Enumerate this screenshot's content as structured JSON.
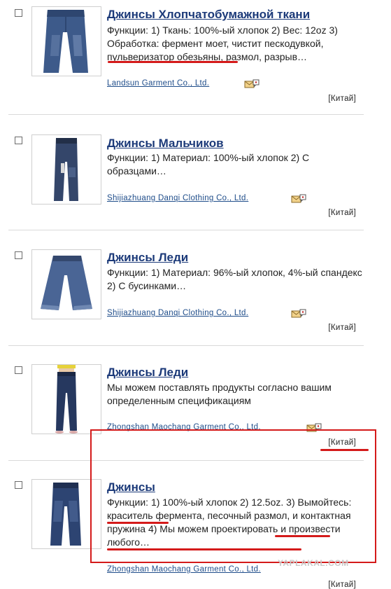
{
  "listings": [
    {
      "title": "Джинсы Хлопчатобумажной ткани",
      "description": "Функции: 1) Ткань: 100%-ый хлопок 2) Вес: 12oz 3) Обработка: фермент моет, чистит пескодувкой, пульверизатор обезьяны, размол, разрыв…",
      "company": "Landsun Garment Co., Ltd.",
      "country": "[Китай]"
    },
    {
      "title": "Джинсы Мальчиков",
      "description": "Функции: 1) Материал: 100%-ый хлопок 2) С образцами…",
      "company": "Shijiazhuang Danqi Clothing Co., Ltd.",
      "country": "[Китай]"
    },
    {
      "title": "Джинсы Леди",
      "description": "Функции: 1) Материал: 96%-ый хлопок, 4%-ый спандекс 2) С бусинками…",
      "company": "Shijiazhuang Danqi Clothing Co., Ltd.",
      "country": "[Китай]"
    },
    {
      "title": "Джинсы Леди",
      "description": "Мы можем поставлять продукты согласно вашим определенным спецификациям",
      "company": "Zhongshan Maochang Garment Co., Ltd.",
      "country": "[Китай]"
    },
    {
      "title": "Джинсы",
      "description": "Функции: 1) 100%-ый хлопок 2) 12.5oz. 3) Вымойтесь: краситель фермента, песочный размол, и контактная пружина 4) Мы можем проектировать и произвести любого…",
      "company": "Zhongshan Maochang Garment Co., Ltd.",
      "country": "[Китай]"
    }
  ],
  "watermark": "YAPLAKAL.COM",
  "colors": {
    "title": "#1c3a79",
    "company_link": "#1f4d8a",
    "highlight": "#d41a1a",
    "denim": "#3d5a8a"
  },
  "icons": {
    "contact": "contact-supplier-icon",
    "checkbox": "select-checkbox"
  }
}
